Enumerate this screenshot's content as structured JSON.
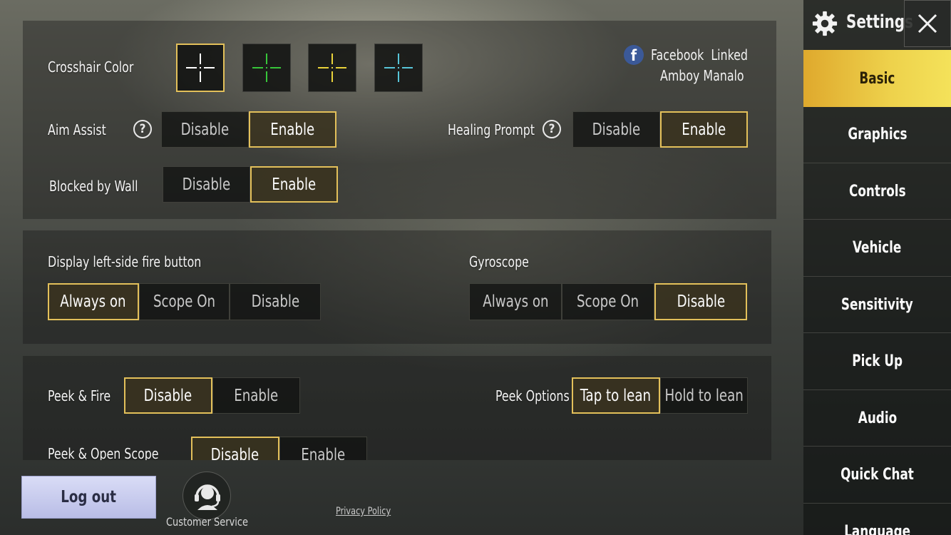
{
  "sidebar": {
    "title": "Settings",
    "items": [
      {
        "label": "Basic",
        "active": true
      },
      {
        "label": "Graphics"
      },
      {
        "label": "Controls"
      },
      {
        "label": "Vehicle"
      },
      {
        "label": "Sensitivity"
      },
      {
        "label": "Pick Up"
      },
      {
        "label": "Audio"
      },
      {
        "label": "Quick Chat"
      },
      {
        "label": "Language"
      }
    ]
  },
  "account": {
    "provider": "Facebook",
    "status": "Linked",
    "name": "Amboy Manalo"
  },
  "crosshair": {
    "label": "Crosshair Color",
    "colors": [
      "#ffffff",
      "#37c63a",
      "#e9d23a",
      "#57c5d8"
    ],
    "selected_index": 0
  },
  "aim_assist": {
    "label": "Aim Assist",
    "options": [
      "Disable",
      "Enable"
    ],
    "selected": "Enable"
  },
  "healing_prompt": {
    "label": "Healing Prompt",
    "options": [
      "Disable",
      "Enable"
    ],
    "selected": "Enable"
  },
  "blocked_by_wall": {
    "label": "Blocked by Wall",
    "options": [
      "Disable",
      "Enable"
    ],
    "selected": "Enable"
  },
  "left_fire": {
    "label": "Display left-side fire button",
    "options": [
      "Always on",
      "Scope On",
      "Disable"
    ],
    "selected": "Always on"
  },
  "gyroscope": {
    "label": "Gyroscope",
    "options": [
      "Always on",
      "Scope On",
      "Disable"
    ],
    "selected": "Disable"
  },
  "peek_fire": {
    "label": "Peek & Fire",
    "options": [
      "Disable",
      "Enable"
    ],
    "selected": "Disable"
  },
  "peek_options": {
    "label": "Peek Options",
    "options": [
      "Tap to lean",
      "Hold to lean"
    ],
    "selected": "Tap to lean"
  },
  "peek_open_scope": {
    "label": "Peek & Open Scope",
    "options": [
      "Disable",
      "Enable"
    ],
    "selected": "Disable"
  },
  "bottom": {
    "logout": "Log out",
    "customer_service": "Customer Service",
    "privacy_policy": "Privacy Policy"
  },
  "colors": {
    "accent_gold": "#e3c05a",
    "nav_active": "#eed24c",
    "logout_bg": "#c9ccef",
    "facebook_blue": "#3b5998"
  }
}
